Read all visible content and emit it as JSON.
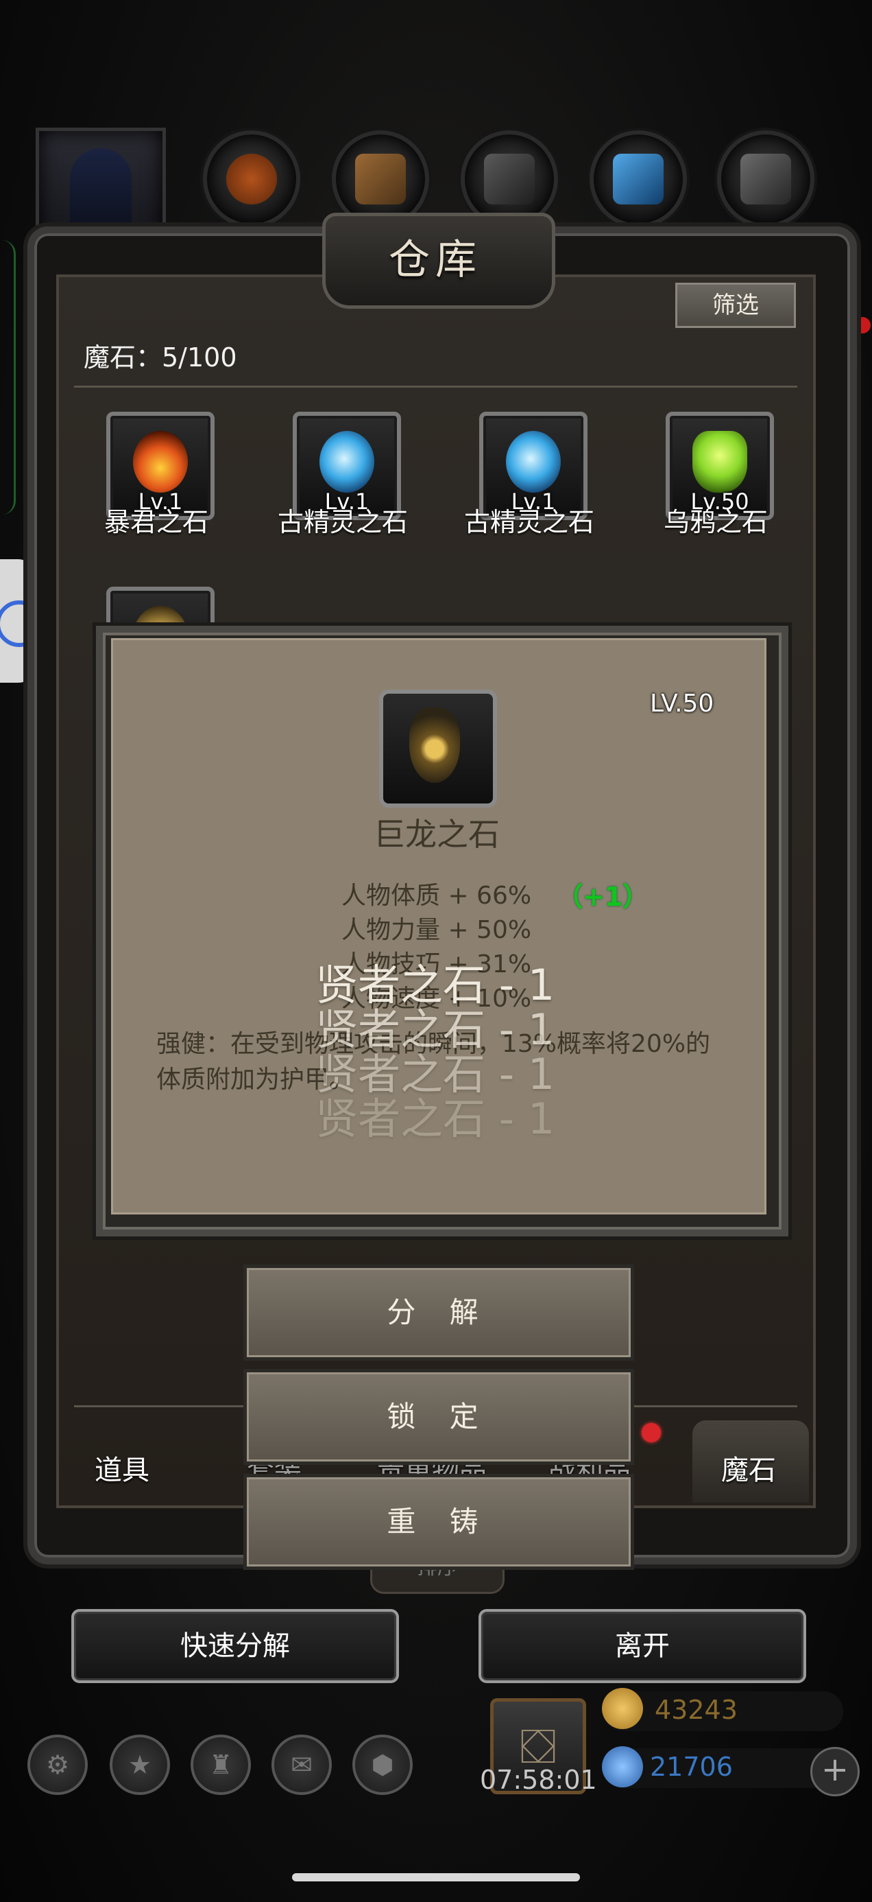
{
  "window": {
    "title": "仓库"
  },
  "toolbar": {
    "filter_label": "筛选"
  },
  "header": {
    "count_label": "魔石：5/100"
  },
  "items": [
    {
      "name": "暴君之石",
      "level": "Lv.1",
      "gem_color": "#e2551a"
    },
    {
      "name": "古精灵之石",
      "level": "Lv.1",
      "gem_color": "#3aa9e6"
    },
    {
      "name": "古精灵之石",
      "level": "Lv.1",
      "gem_color": "#3aa9e6"
    },
    {
      "name": "乌鸦之石",
      "level": "Lv.50",
      "gem_color": "#8ad82a"
    },
    {
      "name": "",
      "level": "",
      "gem_color": "#c9a347"
    }
  ],
  "detail": {
    "level": "LV.50",
    "name": "巨龙之石",
    "stats": [
      "人物体质 + 66%",
      "人物力量 + 50%",
      "人物技巧 + 31%",
      "人物速度 + 10%"
    ],
    "bonus": "（+1）",
    "description": "强健：在受到物理攻击的瞬间，13%概率将20%的体质附加为护甲。"
  },
  "toasts": [
    "贤者之石 - 1",
    "贤者之石 - 1",
    "贤者之石 - 1",
    "贤者之石 - 1"
  ],
  "actions": {
    "decompose": "分 解",
    "lock": "锁 定",
    "reforge": "重 铸"
  },
  "tabs": {
    "items": "道具",
    "equipment": "套装",
    "valuables": "贵重物品",
    "loot": "战利品",
    "magic_stones": "魔石"
  },
  "bottom_bar_hint": "排序",
  "buttons": {
    "quick_decompose": "快速分解",
    "leave": "离开"
  },
  "footer": {
    "timer": "07:58:01",
    "gold": "43243",
    "gems": "21706",
    "plus": "+"
  },
  "colors": {
    "gold_text": "#8a6a2c",
    "gem_text": "#3a78c4",
    "bonus_green": "#11c41d"
  }
}
